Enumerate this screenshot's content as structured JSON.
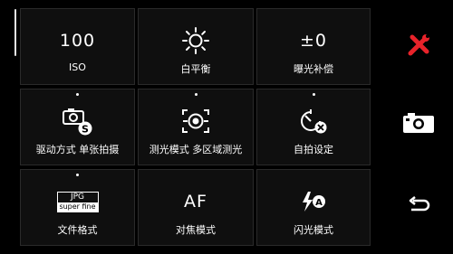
{
  "tiles": [
    {
      "label": "ISO",
      "value": "100",
      "icon": "iso-text-icon",
      "dot": false
    },
    {
      "label": "白平衡",
      "icon": "sun-icon",
      "dot": false
    },
    {
      "label": "曝光补偿",
      "value": "±0",
      "icon": "exposure-text-icon",
      "dot": false
    },
    {
      "label": "驱动方式 单张拍摄",
      "icon": "single-shot-icon",
      "dot": true
    },
    {
      "label": "测光模式 多区域测光",
      "icon": "metering-icon",
      "dot": true
    },
    {
      "label": "自拍设定",
      "icon": "self-timer-off-icon",
      "dot": true
    },
    {
      "label": "文件格式",
      "icon": "jpg-superfine-icon",
      "dot": true,
      "jpg": "JPG",
      "jpg_sub": "super fine"
    },
    {
      "label": "对焦模式",
      "value": "AF",
      "icon": "af-text-icon",
      "dot": false
    },
    {
      "label": "闪光模式",
      "icon": "flash-auto-icon",
      "dot": false,
      "flash_letter": "A"
    }
  ],
  "side": {
    "tools": "tools-icon",
    "camera": "camera-icon",
    "back": "back-arrow-icon"
  },
  "colors": {
    "accent": "#e8232a",
    "tile_bg": "#0f0f0f",
    "tile_border": "#2a2a2a",
    "text": "#ffffff"
  }
}
